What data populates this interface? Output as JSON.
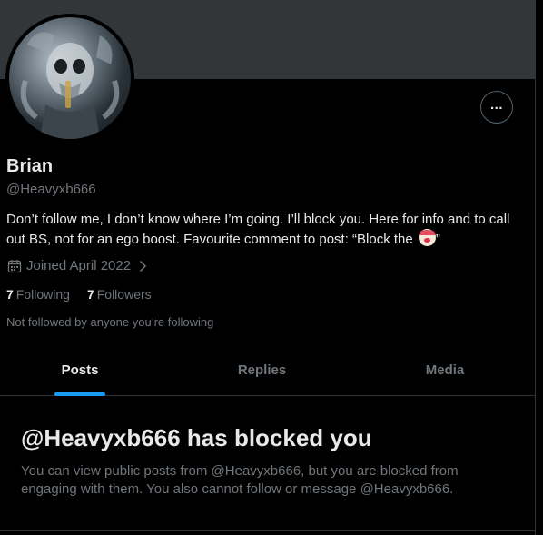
{
  "profile": {
    "name": "Brian",
    "handle": "@Heavyxb666",
    "bio_text": "Don’t follow me, I don’t know where I’m going. I’ll block you. Here for info and to call out BS, not for an ego boost. Favourite comment to post: “Block the ",
    "bio_emoji": "clown-face-emoji",
    "bio_end": "”",
    "joined": "Joined April 2022",
    "following_count": "7",
    "following_label": "Following",
    "followers_count": "7",
    "followers_label": "Followers",
    "not_followed": "Not followed by anyone you’re following"
  },
  "icons": {
    "more": "more-horizontal-icon",
    "calendar": "calendar-icon",
    "chevron": "chevron-right-icon"
  },
  "tabs": [
    {
      "label": "Posts",
      "active": true
    },
    {
      "label": "Replies",
      "active": false
    },
    {
      "label": "Media",
      "active": false
    }
  ],
  "blocked": {
    "title": "@Heavyxb666 has blocked you",
    "description": "You can view public posts from @Heavyxb666, but you are blocked from engaging with them. You also cannot follow or message @Heavyxb666."
  },
  "colors": {
    "background": "#000000",
    "banner": "#333639",
    "accent": "#1d9bf0",
    "secondary_text": "#71767b",
    "primary_text": "#e7e9ea"
  }
}
